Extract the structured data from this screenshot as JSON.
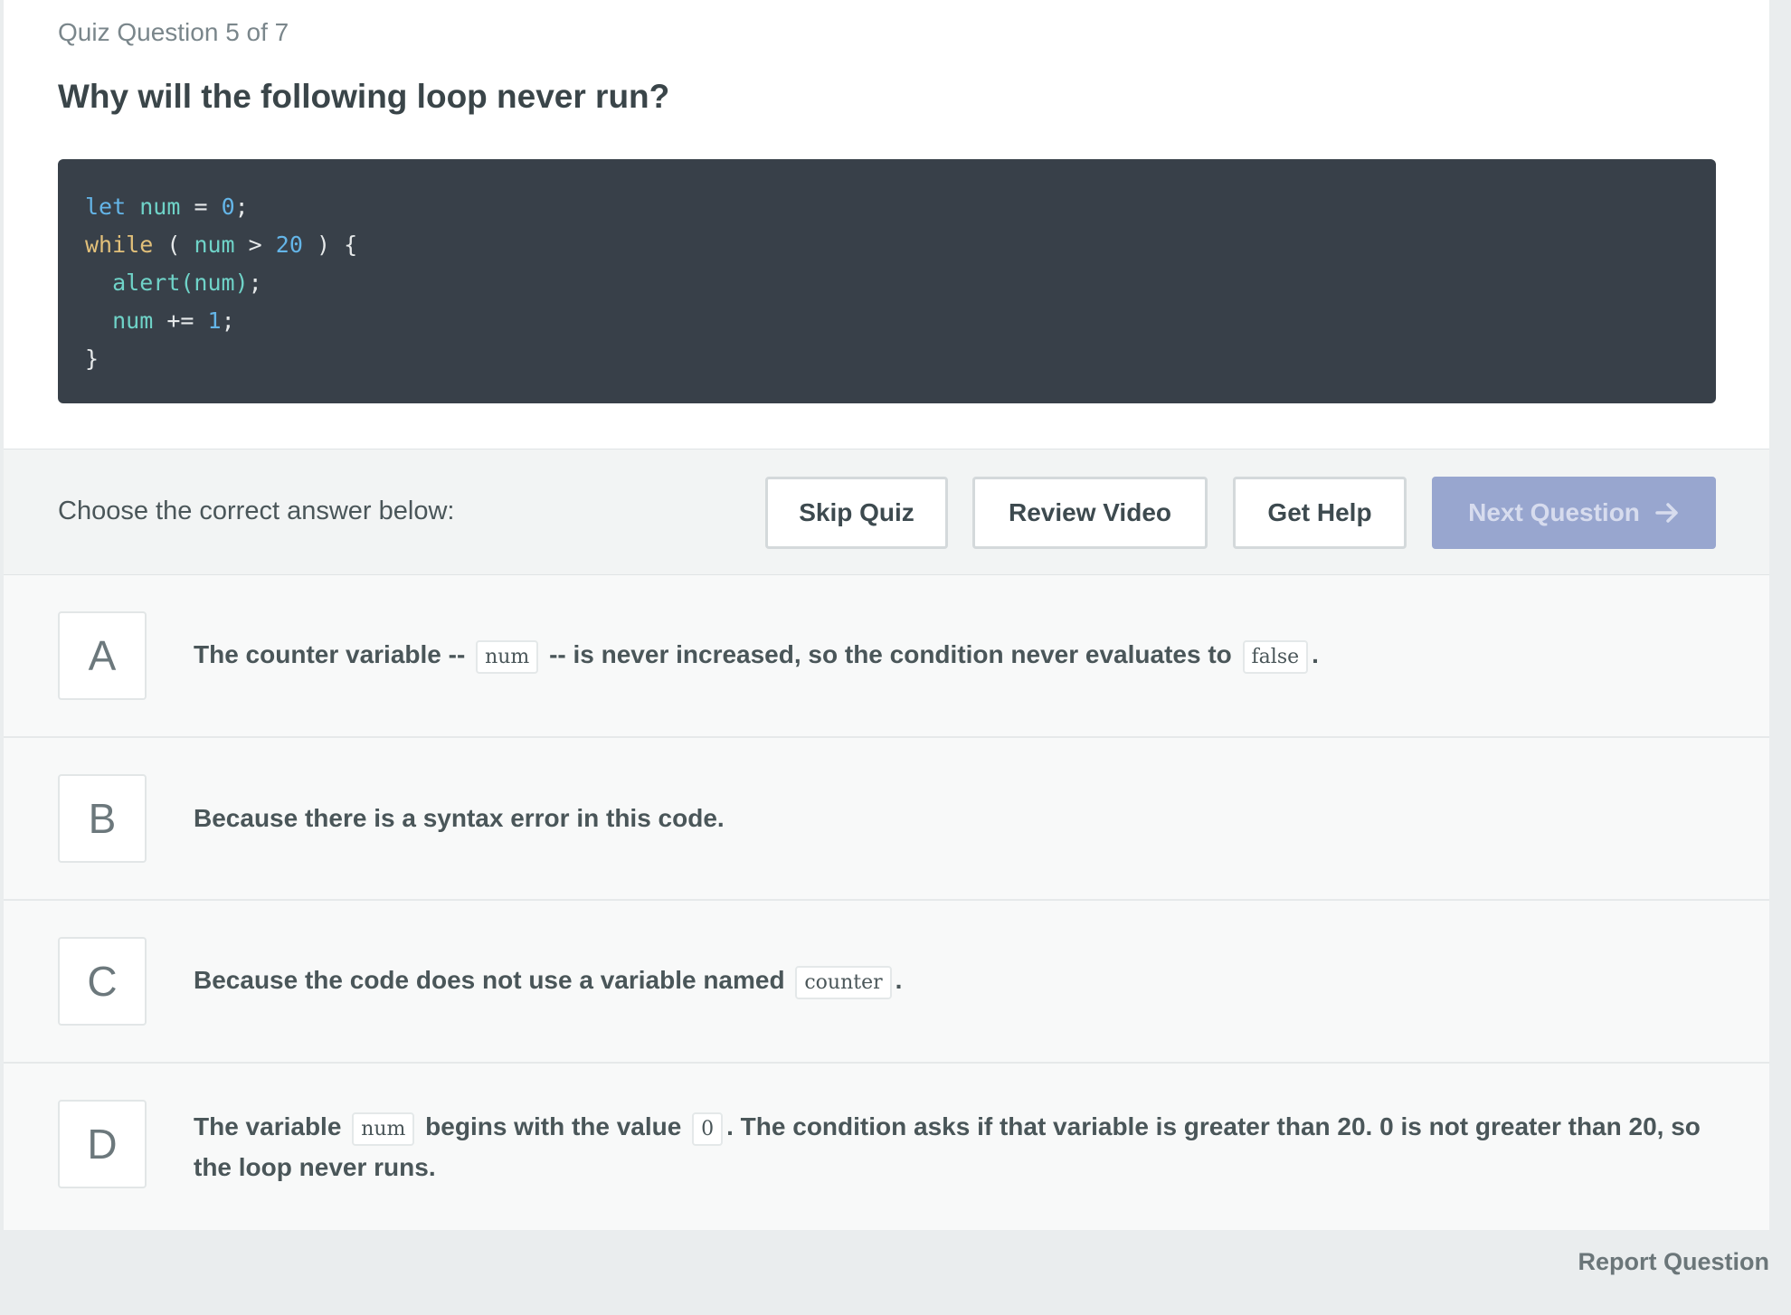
{
  "quiz": {
    "counter": "Quiz Question 5 of 7",
    "question": "Why will the following loop never run?"
  },
  "code": {
    "l1_kw": "let",
    "l1_var": "num",
    "l1_op": "=",
    "l1_num": "0",
    "l1_end": ";",
    "l2_kw": "while",
    "l2_open": "(",
    "l2_var": "num",
    "l2_op": ">",
    "l2_num": "20",
    "l2_close": ") {",
    "l3_fn": "alert",
    "l3_arg": "(num)",
    "l3_end": ";",
    "l4_var": "num",
    "l4_op": "+=",
    "l4_num": "1",
    "l4_end": ";",
    "l5": "}"
  },
  "actions": {
    "choose_label": "Choose the correct answer below:",
    "skip": "Skip Quiz",
    "review": "Review Video",
    "help": "Get Help",
    "next": "Next Question"
  },
  "answers": {
    "a": {
      "letter": "A",
      "t1": "The counter variable --",
      "c1": "num",
      "t2": "-- is never increased, so the condition never evaluates to",
      "c2": "false",
      "t3": "."
    },
    "b": {
      "letter": "B",
      "t1": "Because there is a syntax error in this code."
    },
    "c": {
      "letter": "C",
      "t1": "Because the code does not use a variable named",
      "c1": "counter",
      "t2": "."
    },
    "d": {
      "letter": "D",
      "t1": "The variable",
      "c1": "num",
      "t2": "begins with the value",
      "c2": "0",
      "t3": ". The condition asks if that variable is greater than 20. 0 is not greater than 20, so the loop never runs."
    }
  },
  "footer": {
    "report": "Report Question"
  },
  "colors": {
    "code_bg": "#384049",
    "next_button": "#98a6cf",
    "page_bg": "#eaedee"
  },
  "icons": {
    "next_arrow": "arrow-right-icon"
  }
}
